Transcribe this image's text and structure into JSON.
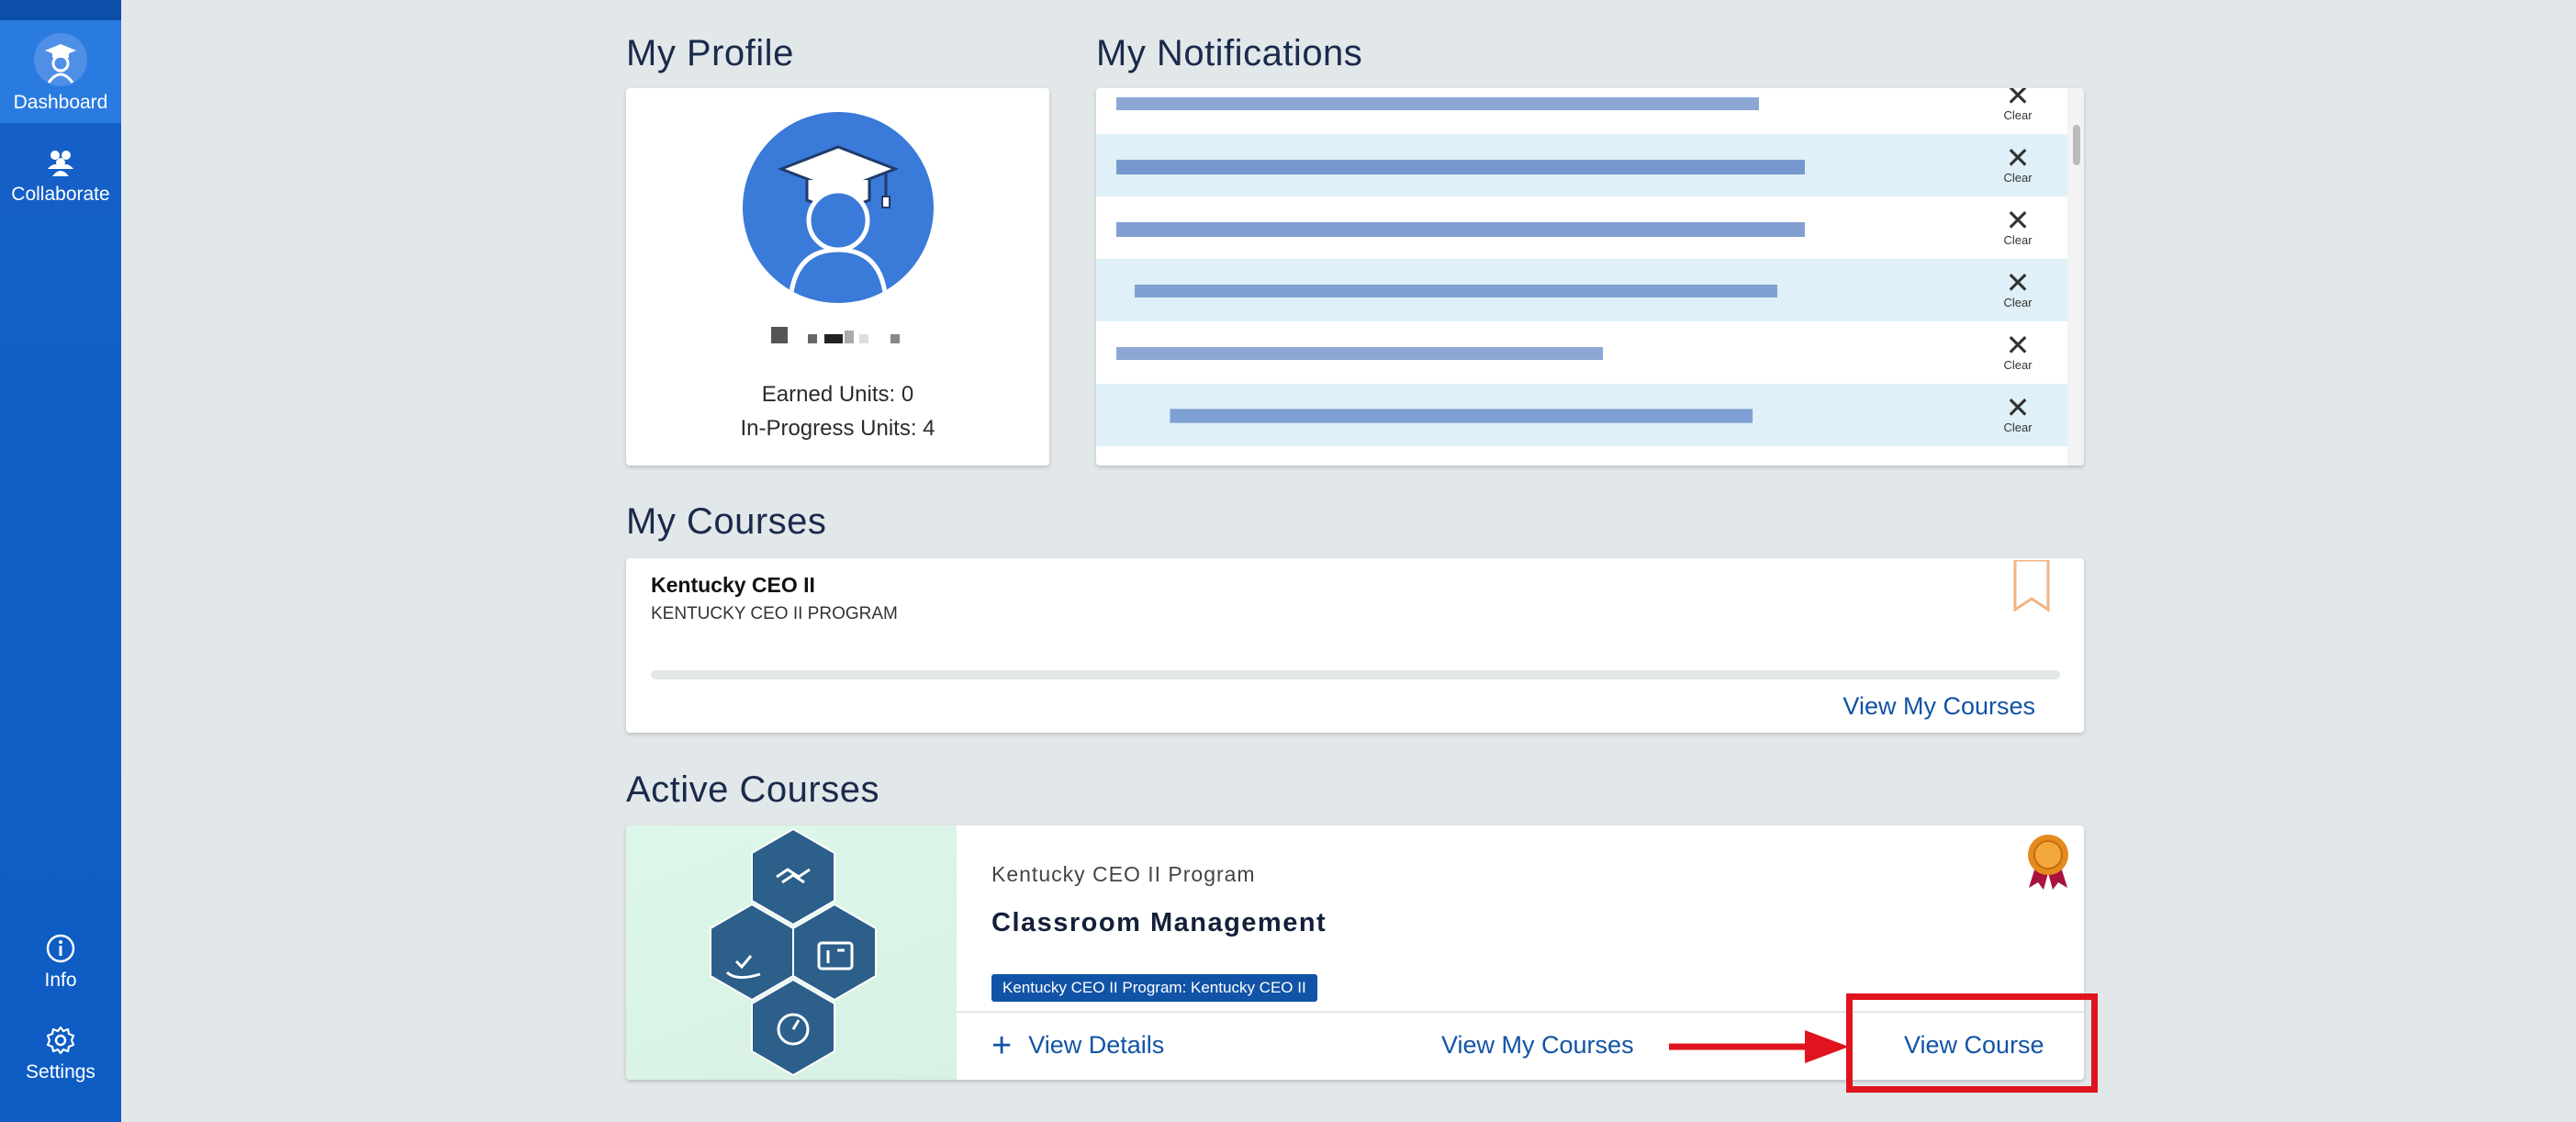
{
  "sidebar": {
    "items": [
      {
        "label": "Dashboard",
        "icon": "graduate-icon"
      },
      {
        "label": "Collaborate",
        "icon": "people-icon"
      },
      {
        "label": "Info",
        "icon": "info-icon"
      },
      {
        "label": "Settings",
        "icon": "gear-icon"
      }
    ]
  },
  "profile": {
    "title": "My Profile",
    "earned_units": "Earned Units: 0",
    "in_progress_units": "In-Progress Units: 4"
  },
  "notifications": {
    "title": "My Notifications",
    "clear_label": "Clear"
  },
  "my_courses": {
    "title": "My Courses",
    "course_name": "Kentucky CEO II",
    "course_program": "KENTUCKY CEO II PROGRAM",
    "progress": 0,
    "view_my_courses": "View My Courses"
  },
  "active_courses": {
    "title": "Active Courses",
    "program": "Kentucky CEO II Program",
    "course_title": "Classroom Management",
    "badge": "Kentucky CEO II Program: Kentucky CEO II",
    "view_details": "View Details",
    "view_my_courses": "View My Courses",
    "view_course": "View Course"
  },
  "colors": {
    "sidebar": "#1561c8",
    "accent": "#1153a6",
    "highlight": "#e0141e",
    "background": "#e2e7ea"
  }
}
